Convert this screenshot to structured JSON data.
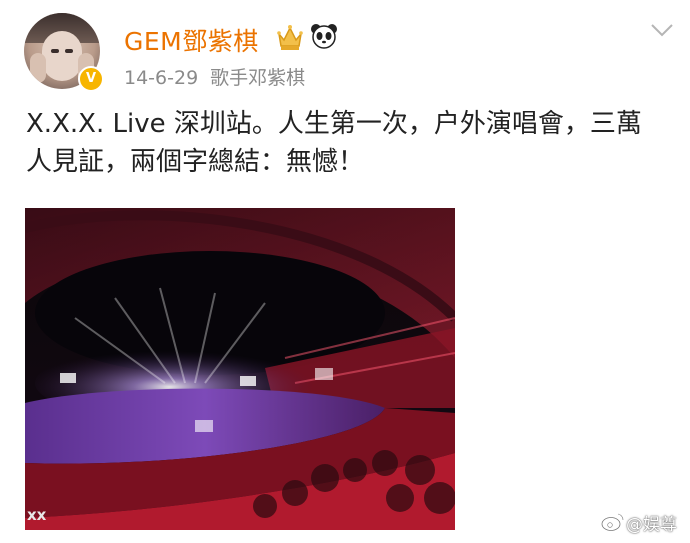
{
  "post": {
    "username": "GEM鄧紫棋",
    "date": "14-6-29",
    "source": "歌手邓紫棋",
    "text": "X.X.X. Live 深圳站。人生第一次，户外演唱會，三萬人見証，兩個字總結：無憾！"
  },
  "photo": {
    "watermark": "xx"
  },
  "footer": {
    "watermark": "@娱尊"
  },
  "icons": {
    "verified": "verified-badge-icon",
    "crown": "crown-icon",
    "panda": "panda-icon",
    "more": "chevron-down-icon",
    "weibo": "weibo-logo-icon"
  },
  "colors": {
    "username": "#eb7300",
    "meta": "#8a8a8a",
    "verified": "#f7b500"
  }
}
